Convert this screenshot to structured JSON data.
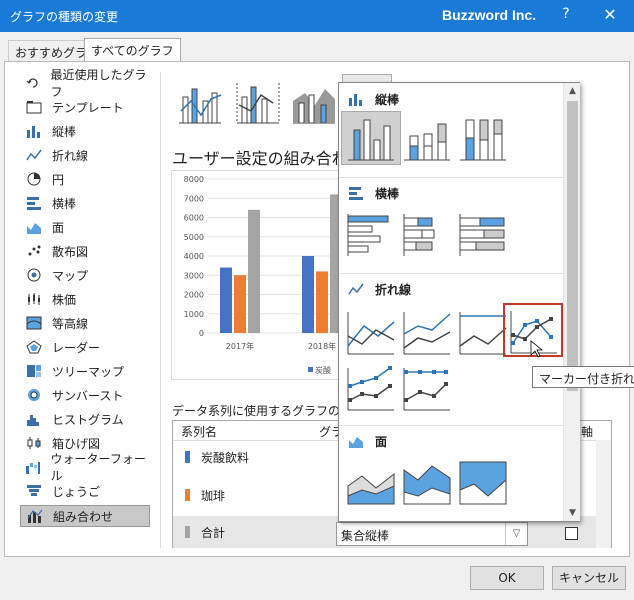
{
  "window": {
    "title": "グラフの種類の変更",
    "brand": "Buzzword Inc.",
    "help": "?",
    "close": "✕"
  },
  "tabs": [
    {
      "label": "おすすめグラフ"
    },
    {
      "label": "すべてのグラフ"
    }
  ],
  "sidebar": {
    "items": [
      {
        "label": "最近使用したグラフ",
        "icon": "recent-icon"
      },
      {
        "label": "テンプレート",
        "icon": "folder-icon"
      },
      {
        "label": "縦棒",
        "icon": "column-chart-icon"
      },
      {
        "label": "折れ線",
        "icon": "line-chart-icon"
      },
      {
        "label": "円",
        "icon": "pie-chart-icon"
      },
      {
        "label": "横棒",
        "icon": "bar-chart-icon"
      },
      {
        "label": "面",
        "icon": "area-chart-icon"
      },
      {
        "label": "散布図",
        "icon": "scatter-chart-icon"
      },
      {
        "label": "マップ",
        "icon": "map-chart-icon"
      },
      {
        "label": "株価",
        "icon": "stock-chart-icon"
      },
      {
        "label": "等高線",
        "icon": "surface-chart-icon"
      },
      {
        "label": "レーダー",
        "icon": "radar-chart-icon"
      },
      {
        "label": "ツリーマップ",
        "icon": "treemap-chart-icon"
      },
      {
        "label": "サンバースト",
        "icon": "sunburst-chart-icon"
      },
      {
        "label": "ヒストグラム",
        "icon": "histogram-chart-icon"
      },
      {
        "label": "箱ひげ図",
        "icon": "boxwhisker-chart-icon"
      },
      {
        "label": "ウォーターフォール",
        "icon": "waterfall-chart-icon"
      },
      {
        "label": "じょうご",
        "icon": "funnel-chart-icon"
      },
      {
        "label": "組み合わせ",
        "icon": "combo-chart-icon"
      }
    ]
  },
  "main": {
    "heading": "ユーザー設定の組み合わ",
    "series_section_title": "データ系列に使用するグラフの種類",
    "table": {
      "headers": [
        "系列名",
        "グラ",
        "軸"
      ],
      "rows": [
        {
          "name": "炭酸飲料",
          "color": "#4472c4"
        },
        {
          "name": "珈琲",
          "color": "#ed7d31"
        },
        {
          "name": "合計",
          "color": "#a5a5a5"
        }
      ]
    },
    "combo_value": "集合縦棒"
  },
  "chart_data": {
    "type": "bar",
    "categories": [
      "2017年",
      "2018年"
    ],
    "series": [
      {
        "values": [
          3400,
          4000
        ]
      },
      {
        "values": [
          3000,
          3200
        ]
      },
      {
        "values": [
          6400,
          7200
        ]
      }
    ],
    "colors": [
      "#4472c4",
      "#ed7d31",
      "#a5a5a5"
    ],
    "ylim": [
      0,
      8000
    ],
    "y_ticks": [
      "0",
      "1000",
      "2000",
      "3000",
      "4000",
      "5000",
      "6000",
      "7000",
      "8000"
    ],
    "legend_fragment": "炭酸"
  },
  "dropdown": {
    "sections": [
      {
        "title": "縦棒",
        "icon": "column-chart-icon"
      },
      {
        "title": "横棒",
        "icon": "bar-chart-icon"
      },
      {
        "title": "折れ線",
        "icon": "line-chart-icon"
      },
      {
        "title": "面",
        "icon": "area-chart-icon"
      }
    ],
    "tooltip": "マーカー付き折れ線"
  },
  "buttons": {
    "ok": "OK",
    "cancel": "キャンセル"
  }
}
